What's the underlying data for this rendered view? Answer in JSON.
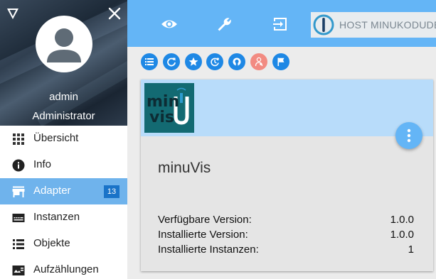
{
  "sidebar": {
    "user": {
      "name": "admin",
      "role": "Administrator"
    },
    "items": [
      {
        "label": "Übersicht",
        "icon": "grid-icon"
      },
      {
        "label": "Info",
        "icon": "info-icon"
      },
      {
        "label": "Adapter",
        "icon": "store-icon",
        "badge": "13",
        "active": true
      },
      {
        "label": "Instanzen",
        "icon": "instances-icon"
      },
      {
        "label": "Objekte",
        "icon": "list-icon"
      },
      {
        "label": "Aufzählungen",
        "icon": "enums-icon"
      }
    ]
  },
  "topbar": {
    "icons": [
      "eye-icon",
      "wrench-icon",
      "logout-icon"
    ],
    "host_label": "HOST MINUKODUDE"
  },
  "toolbar": {
    "buttons": [
      "list-view-icon",
      "refresh-icon",
      "star-icon",
      "update-icon",
      "github-icon",
      "expert-mode-icon",
      "flag-icon"
    ]
  },
  "card": {
    "logo_text_line1": "min",
    "logo_text_line2": "vis",
    "logo_letter": "U",
    "title": "minuVis",
    "rows": [
      {
        "label": "Verfügbare Version:",
        "value": "1.0.0"
      },
      {
        "label": "Installierte Version:",
        "value": "1.0.0"
      },
      {
        "label": "Installierte Instanzen:",
        "value": "1"
      }
    ]
  },
  "colors": {
    "accent": "#64b5f6",
    "active_nav": "#6fb3ec",
    "badge": "#1a73c8",
    "round_button": "#1e88e5",
    "expert_button": "#f28b82",
    "card_header": "#b8dcfa",
    "logo_bg": "#136a72"
  }
}
